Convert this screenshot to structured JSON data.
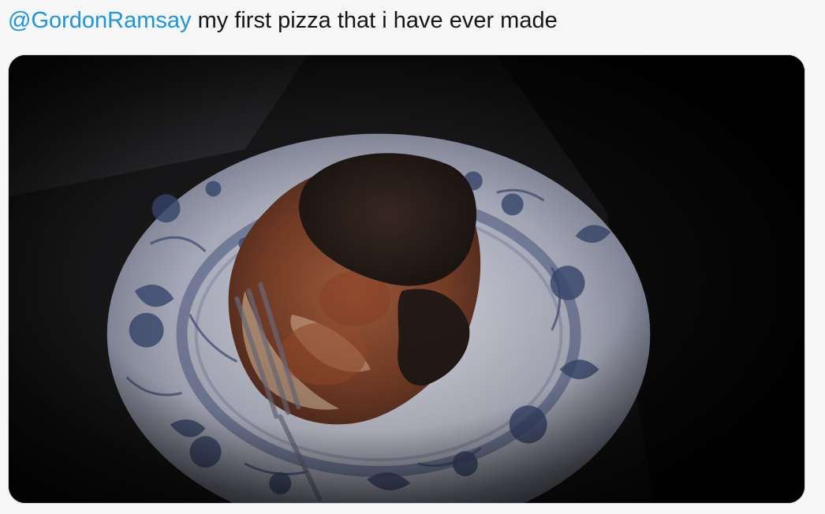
{
  "tweet": {
    "mention": "@GordonRamsay",
    "text": " my first pizza that i have ever made"
  },
  "media": {
    "description_icon": "photo",
    "colors": {
      "background": "#0d0d0d",
      "plate": "#b9bccb",
      "plate_pattern": "#3e4e78",
      "crust": "#c9a98d",
      "sauce": "#7a3a22",
      "burnt": "#2a1d17"
    }
  }
}
